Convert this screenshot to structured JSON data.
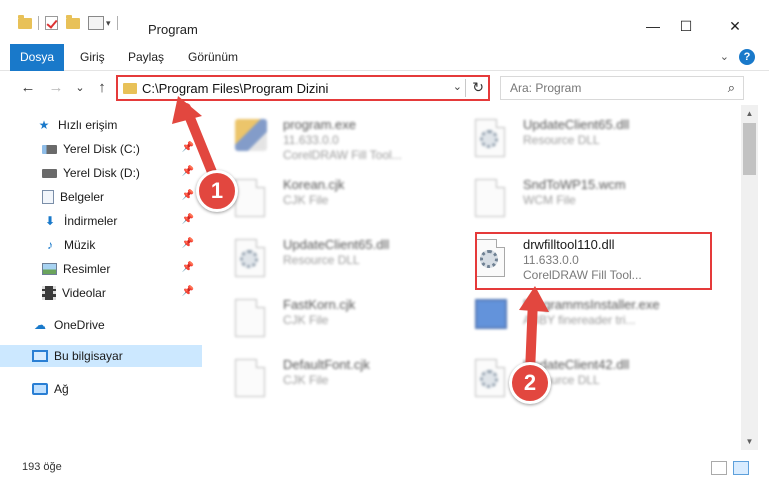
{
  "window": {
    "title": "Program",
    "minimize_glyph": "—",
    "maximize_glyph": "☐",
    "close_glyph": "✕"
  },
  "ribbon": {
    "tabs": [
      "Dosya",
      "Giriş",
      "Paylaş",
      "Görünüm"
    ],
    "help_label": "?",
    "expand_glyph": "⌄"
  },
  "nav": {
    "back_glyph": "←",
    "forward_glyph": "→",
    "recent_glyph": "⌄",
    "up_glyph": "↑",
    "address_path": "C:\\Program Files\\Program Dizini",
    "address_dropdown_glyph": "⌄",
    "refresh_glyph": "↻",
    "search_placeholder": "Ara: Program",
    "search_glyph": "⌕"
  },
  "sidebar": {
    "items": [
      {
        "label": "Hızlı erişim",
        "icon": "star-icon",
        "pinned": false
      },
      {
        "label": "Yerel Disk (C:)",
        "icon": "drive-icon",
        "pinned": true
      },
      {
        "label": "Yerel Disk (D:)",
        "icon": "drive-icon",
        "pinned": true
      },
      {
        "label": "Belgeler",
        "icon": "documents-icon",
        "pinned": true
      },
      {
        "label": "İndirmeler",
        "icon": "downloads-icon",
        "pinned": true
      },
      {
        "label": "Müzik",
        "icon": "music-icon",
        "pinned": true
      },
      {
        "label": "Resimler",
        "icon": "pictures-icon",
        "pinned": true
      },
      {
        "label": "Videolar",
        "icon": "videos-icon",
        "pinned": true
      },
      {
        "label": "OneDrive",
        "icon": "cloud-icon",
        "pinned": false
      },
      {
        "label": "Bu bilgisayar",
        "icon": "computer-icon",
        "pinned": false,
        "selected": true
      },
      {
        "label": "Ağ",
        "icon": "network-icon",
        "pinned": false
      }
    ],
    "pin_glyph": "📌"
  },
  "files": [
    {
      "name": "program.exe",
      "line1": "11.633.0.0",
      "line2": "CorelDRAW Fill Tool...",
      "icon": "exe-icon"
    },
    {
      "name": "UpdateClient65.dll",
      "line1": "Resource DLL",
      "line2": "",
      "icon": "dll-gear-icon"
    },
    {
      "name": "Korean.cjk",
      "line1": "CJK File",
      "line2": "",
      "icon": "file-icon"
    },
    {
      "name": "SndToWP15.wcm",
      "line1": "WCM File",
      "line2": "",
      "icon": "file-icon"
    },
    {
      "name": "UpdateClient65.dll",
      "line1": "Resource DLL",
      "line2": "",
      "icon": "dll-gear-icon"
    },
    {
      "name": "drwfilltool110.dll",
      "line1": "11.633.0.0",
      "line2": "CorelDRAW Fill Tool...",
      "icon": "dll-gear-icon",
      "highlighted": true
    },
    {
      "name": "FastKorn.cjk",
      "line1": "CJK File",
      "line2": "",
      "icon": "file-icon"
    },
    {
      "name": "ProgrammsInstaller.exe",
      "line1": "ABBY finereader tri...",
      "line2": "",
      "icon": "installer-icon"
    },
    {
      "name": "DefaultFont.cjk",
      "line1": "CJK File",
      "line2": "",
      "icon": "file-icon"
    },
    {
      "name": "UpdateClient42.dll",
      "line1": "Resource DLL",
      "line2": "",
      "icon": "dll-gear-icon"
    }
  ],
  "status": {
    "item_count": "193 öğe"
  },
  "annotations": {
    "step1": "1",
    "step2": "2",
    "color": "#e2473f"
  },
  "scroll": {
    "up_glyph": "▲",
    "down_glyph": "▼"
  }
}
